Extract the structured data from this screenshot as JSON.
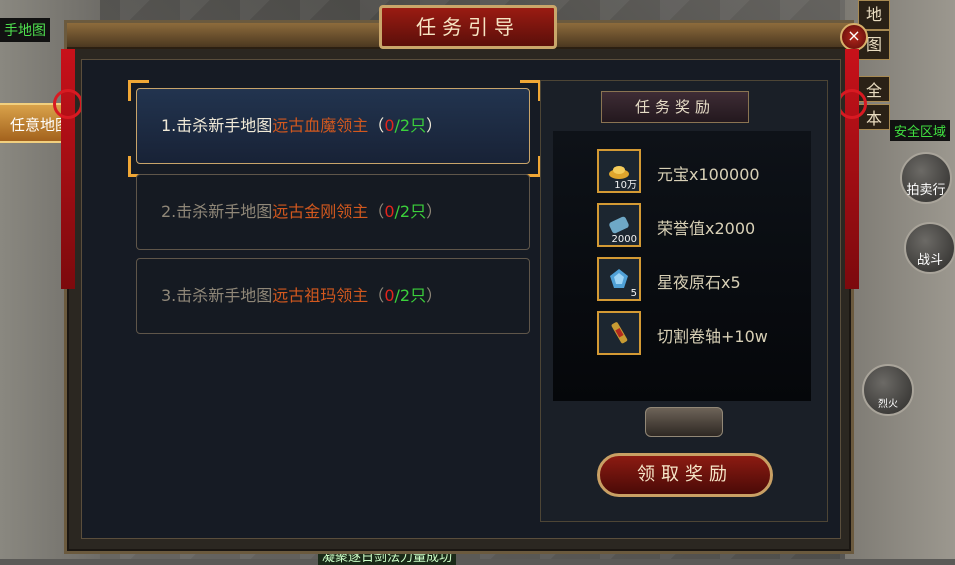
{
  "background": {
    "top_left_map_label": "手地图",
    "arbitrary_map_button": "任意地图",
    "side_tabs": [
      "地",
      "图",
      "全",
      "本"
    ],
    "safe_zone": "安全区域",
    "auction_label": "拍卖行",
    "battle_label": "战斗",
    "fire_label": "烈火",
    "bottom_message": "凝聚逐日剑法力量成功"
  },
  "dialog": {
    "title": "任务引导",
    "close_label": "×"
  },
  "quests": [
    {
      "prefix": "1.击杀新手地图",
      "target": "远古血魔领主",
      "open": "（",
      "current": "0",
      "total": "/2只",
      "close": "）"
    },
    {
      "prefix": "2.击杀新手地图",
      "target": "远古金刚领主",
      "open": "（",
      "current": "0",
      "total": "/2只",
      "close": "）"
    },
    {
      "prefix": "3.击杀新手地图",
      "target": "远古祖玛领主",
      "open": "（",
      "current": "0",
      "total": "/2只",
      "close": "）"
    }
  ],
  "rewards": {
    "header": "任务奖励",
    "items": [
      {
        "name": "元宝x100000",
        "count": "10万",
        "icon": "gold-ingot-icon"
      },
      {
        "name": "荣誉值x2000",
        "count": "2000",
        "icon": "honor-scroll-icon"
      },
      {
        "name": "星夜原石x5",
        "count": "5",
        "icon": "star-stone-icon"
      },
      {
        "name": "切割卷轴+10w",
        "count": "",
        "icon": "cutting-scroll-icon"
      }
    ],
    "claim_button": "领取奖励"
  },
  "colors": {
    "target_text": "#d2581e",
    "progress_current": "#e3251c",
    "progress_total": "#3bd13b",
    "accent_gold": "#c9a66a"
  }
}
